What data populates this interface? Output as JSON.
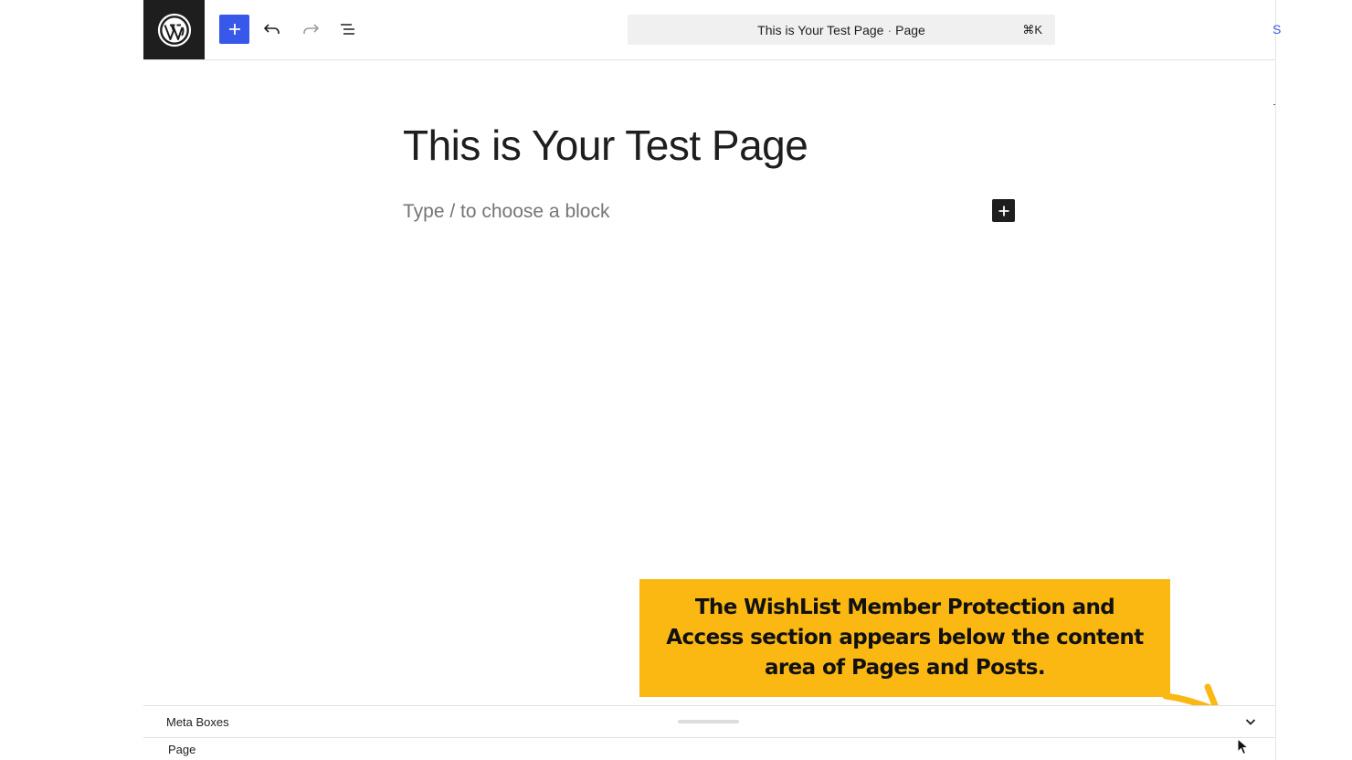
{
  "header": {
    "command_bar": {
      "title": "This is Your Test Page",
      "separator": "·",
      "type": "Page",
      "shortcut": "⌘K"
    },
    "edge_mark": "S"
  },
  "editor": {
    "title": "This is Your Test Page",
    "block_placeholder": "Type / to choose a block"
  },
  "callout": {
    "text": "The WishList Member Protection and Access section appears below the content area of Pages and Posts.",
    "background": "#fbb813"
  },
  "meta_boxes": {
    "label": "Meta Boxes",
    "section": "Page"
  },
  "colors": {
    "accent": "#3858e9",
    "dark": "#1e1e1e"
  },
  "icons": [
    "wordpress-logo-icon",
    "plus-icon",
    "undo-icon",
    "redo-icon",
    "list-view-icon",
    "chevron-down-icon",
    "arrow-icon",
    "cursor-icon"
  ]
}
